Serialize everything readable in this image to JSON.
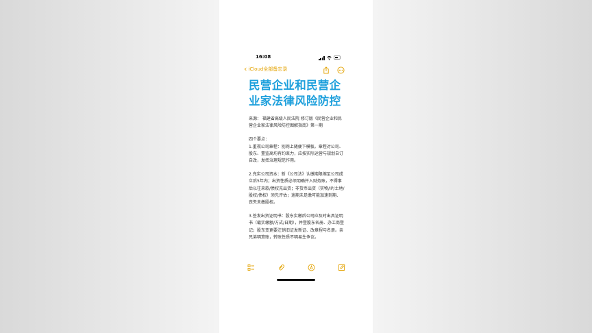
{
  "status_bar": {
    "time": "16:08"
  },
  "nav": {
    "back_label": "iCloud全部备忘录"
  },
  "note": {
    "title": "民营企业和民营企业家法律风险防控",
    "paragraphs": [
      "来源：  福建省高级人民法院  修订版《民营企业和民营企业家法律风险防控图解指南》第一期",
      "四个要点：",
      "1.重视公司章程：别网上随便下模板。章程对公司、股东、董监高均有约束力，应按实际运营与规划自订自改，发挥治理规范作用。",
      "2.充实公司资本：新《公司法》认缴期限缩至公司成立后5年内；出资性质必须明确并入财务账，不得事后以往来款/债权充出资；非货币出资（实物/IP/土地/股权/债权）须先评估；逾期未足缴可能加速到期、丧失未缴股权。",
      "3.签发出资证明书：股东实缴后公司应及时出具证明书（载实缴额/方式/日期），并登股东名册、办工商登记；股东变更要注销旧证发新证、改章程与名册。亲兄弟明算账，转账性质不明易生争议。"
    ]
  },
  "colors": {
    "accent": "#e3a200",
    "title": "#1ea0dc"
  },
  "icons": {
    "back": "chevron-left-icon",
    "share": "share-icon",
    "more": "more-icon",
    "checklist": "checklist-icon",
    "attach": "paperclip-icon",
    "markup": "markup-pen-icon",
    "compose": "compose-icon"
  }
}
